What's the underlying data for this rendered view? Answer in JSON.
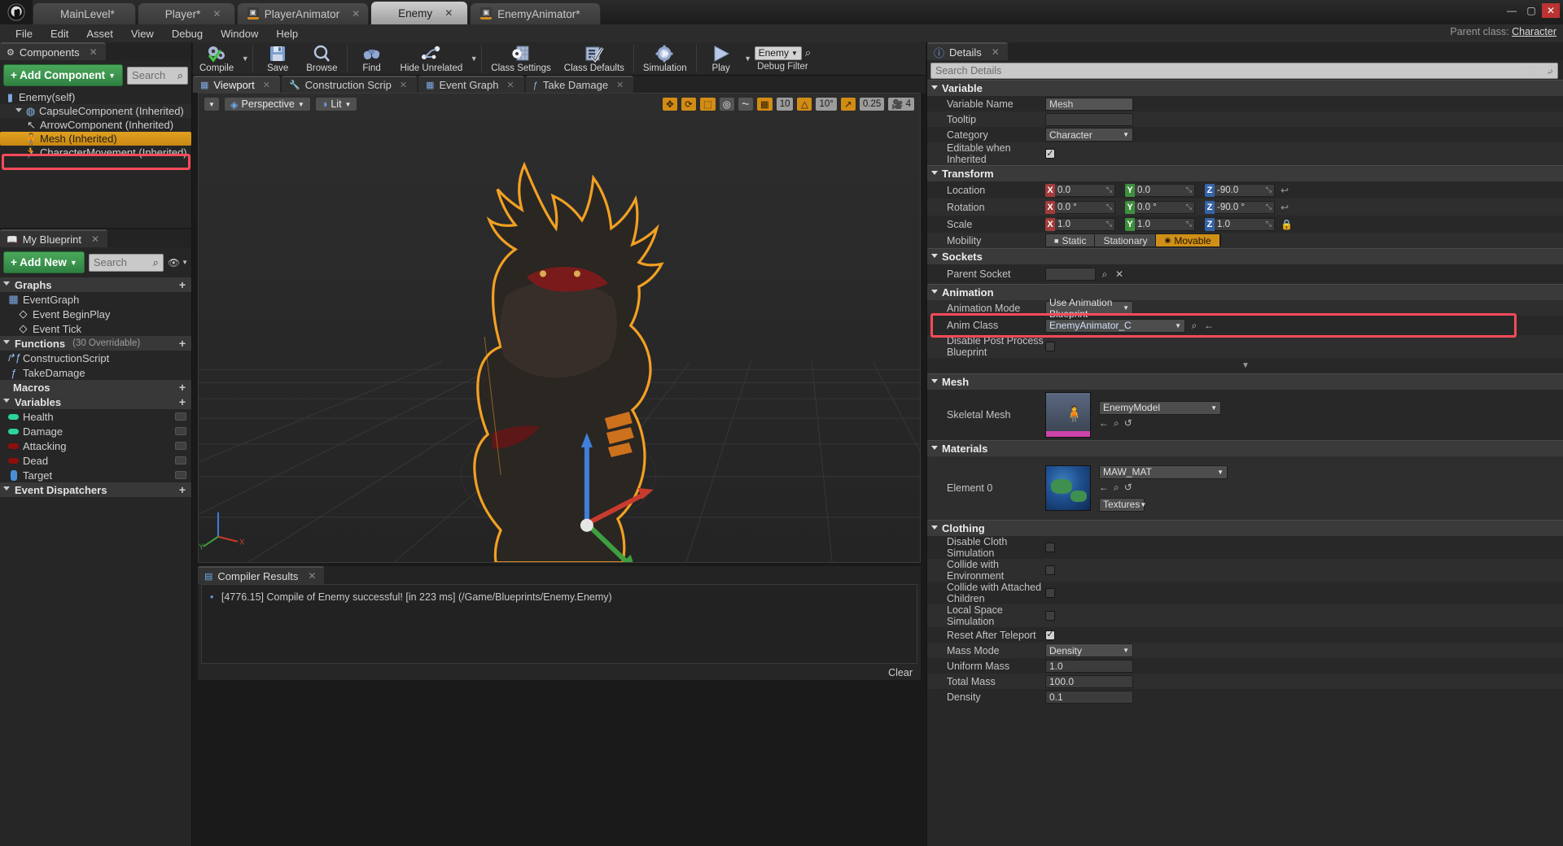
{
  "window": {
    "tabs": [
      {
        "label": "MainLevel*",
        "icon": "level-icon",
        "active": false,
        "closable": false
      },
      {
        "label": "Player*",
        "icon": "blueprint-icon",
        "active": false,
        "closable": true
      },
      {
        "label": "PlayerAnimator",
        "icon": "anim-blueprint-icon",
        "active": false,
        "closable": true
      },
      {
        "label": "Enemy",
        "icon": "blueprint-icon",
        "active": true,
        "closable": true
      },
      {
        "label": "EnemyAnimator*",
        "icon": "anim-blueprint-icon",
        "active": false,
        "closable": false
      }
    ],
    "controls": [
      "minimize",
      "maximize",
      "close"
    ]
  },
  "menu": {
    "items": [
      "File",
      "Edit",
      "Asset",
      "View",
      "Debug",
      "Window",
      "Help"
    ],
    "parent_class_label": "Parent class:",
    "parent_class_value": "Character"
  },
  "components": {
    "tab_label": "Components",
    "add_button": "+ Add Component",
    "search_placeholder": "Search",
    "tree": [
      {
        "label": "Enemy(self)",
        "icon": "blueprint-self-icon",
        "indent": 0,
        "selected": false
      },
      {
        "label": "CapsuleComponent (Inherited)",
        "icon": "capsule-icon",
        "indent": 1,
        "selected": false
      },
      {
        "label": "ArrowComponent (Inherited)",
        "icon": "arrow-icon",
        "indent": 2,
        "selected": false
      },
      {
        "label": "Mesh (Inherited)",
        "icon": "skeletal-mesh-icon",
        "indent": 2,
        "selected": true
      },
      {
        "label": "CharacterMovement (Inherited)",
        "icon": "movement-icon",
        "indent": 2,
        "selected": false
      }
    ]
  },
  "myblueprint": {
    "tab_label": "My Blueprint",
    "add_new_button": "+ Add New",
    "search_placeholder": "Search",
    "sections": [
      {
        "name": "Graphs",
        "sub": "",
        "items": [
          {
            "label": "EventGraph",
            "icon": "graph-icon",
            "indent": 1
          },
          {
            "label": "Event BeginPlay",
            "icon": "event-node-icon",
            "indent": 2
          },
          {
            "label": "Event Tick",
            "icon": "event-node-icon",
            "indent": 2
          }
        ]
      },
      {
        "name": "Functions",
        "sub": "(30 Overridable)",
        "items": [
          {
            "label": "ConstructionScript",
            "icon": "function-override-icon",
            "indent": 1
          },
          {
            "label": "TakeDamage",
            "icon": "function-icon",
            "indent": 1
          }
        ]
      },
      {
        "name": "Macros",
        "sub": "",
        "items": []
      },
      {
        "name": "Variables",
        "sub": "",
        "items": [
          {
            "label": "Health",
            "icon": "float-var-icon",
            "color": "#2bd49c",
            "indent": 1
          },
          {
            "label": "Damage",
            "icon": "float-var-icon",
            "color": "#2bd49c",
            "indent": 1
          },
          {
            "label": "Attacking",
            "icon": "bool-var-icon",
            "color": "#8f0d0d",
            "indent": 1
          },
          {
            "label": "Dead",
            "icon": "bool-var-icon",
            "color": "#8f0d0d",
            "indent": 1
          },
          {
            "label": "Target",
            "icon": "object-var-icon",
            "color": "#4a8fd8",
            "indent": 1
          }
        ]
      },
      {
        "name": "Event Dispatchers",
        "sub": "",
        "items": []
      }
    ]
  },
  "toolbar": {
    "buttons": [
      {
        "label": "Compile",
        "icon": "compile-icon",
        "caret": true
      },
      {
        "label": "Save",
        "icon": "save-icon",
        "caret": false
      },
      {
        "label": "Browse",
        "icon": "browse-icon",
        "caret": false
      },
      {
        "label": "Find",
        "icon": "find-icon",
        "caret": false
      },
      {
        "label": "Hide Unrelated",
        "icon": "hide-unrelated-icon",
        "caret": true
      },
      {
        "label": "Class Settings",
        "icon": "class-settings-icon",
        "caret": false
      },
      {
        "label": "Class Defaults",
        "icon": "class-defaults-icon",
        "caret": false
      },
      {
        "label": "Simulation",
        "icon": "simulation-icon",
        "caret": false
      },
      {
        "label": "Play",
        "icon": "play-icon",
        "caret": true
      }
    ],
    "debug_filter_label": "Debug Filter",
    "debug_filter_value": "Enemy"
  },
  "editor_tabs": [
    {
      "label": "Viewport",
      "icon": "viewport-icon",
      "active": true,
      "closable": true
    },
    {
      "label": "Construction Scrip",
      "icon": "construction-icon",
      "active": false,
      "closable": true
    },
    {
      "label": "Event Graph",
      "icon": "event-graph-icon",
      "active": false,
      "closable": true
    },
    {
      "label": "Take Damage",
      "icon": "function-graph-icon",
      "active": false,
      "closable": true
    }
  ],
  "viewport": {
    "view_mode": "Perspective",
    "lit_mode": "Lit",
    "snap_values": {
      "grid_snap": "10",
      "rotation_snap": "10°",
      "scale_snap": "0.25",
      "camera_speed": "4"
    }
  },
  "compiler_results": {
    "tab_label": "Compiler Results",
    "messages": [
      "[4776.15] Compile of Enemy successful! [in 223 ms] (/Game/Blueprints/Enemy.Enemy)"
    ],
    "clear_label": "Clear"
  },
  "details": {
    "tab_label": "Details",
    "search_placeholder": "Search Details",
    "sections": [
      {
        "name": "Variable",
        "rows": [
          {
            "label": "Variable Name",
            "type": "text",
            "value": "Mesh",
            "readonly": true
          },
          {
            "label": "Tooltip",
            "type": "text",
            "value": "",
            "readonly": false
          },
          {
            "label": "Category",
            "type": "combo",
            "value": "Character"
          },
          {
            "label": "Editable when Inherited",
            "type": "check",
            "value": true
          }
        ]
      },
      {
        "name": "Transform",
        "rows": [
          {
            "label": "Location",
            "type": "vector",
            "value": [
              "0.0",
              "0.0",
              "-90.0"
            ],
            "revert": true
          },
          {
            "label": "Rotation",
            "type": "vector",
            "value": [
              "0.0 °",
              "0.0 °",
              "-90.0 °"
            ],
            "revert": true
          },
          {
            "label": "Scale",
            "type": "vector",
            "value": [
              "1.0",
              "1.0",
              "1.0"
            ],
            "lock": true
          },
          {
            "label": "Mobility",
            "type": "mobility",
            "value": "Movable",
            "options": [
              "Static",
              "Stationary",
              "Movable"
            ]
          }
        ]
      },
      {
        "name": "Sockets",
        "rows": [
          {
            "label": "Parent Socket",
            "type": "socket",
            "value": ""
          }
        ]
      },
      {
        "name": "Animation",
        "rows": [
          {
            "label": "Animation Mode",
            "type": "combo",
            "value": "Use Animation Blueprint"
          },
          {
            "label": "Anim Class",
            "type": "asset-combo",
            "value": "EnemyAnimator_C",
            "highlighted": true
          },
          {
            "label": "Disable Post Process Blueprint",
            "type": "check",
            "value": false
          }
        ]
      },
      {
        "name": "Mesh",
        "rows": [
          {
            "label": "Skeletal Mesh",
            "type": "asset-thumb",
            "value": "EnemyModel"
          }
        ]
      },
      {
        "name": "Materials",
        "rows": [
          {
            "label": "Element 0",
            "type": "asset-thumb-mat",
            "value": "MAW_MAT",
            "extra_button": "Textures"
          }
        ]
      },
      {
        "name": "Clothing",
        "rows": [
          {
            "label": "Disable Cloth Simulation",
            "type": "check",
            "value": false
          },
          {
            "label": "Collide with Environment",
            "type": "check",
            "value": false
          },
          {
            "label": "Collide with Attached Children",
            "type": "check",
            "value": false
          },
          {
            "label": "Local Space Simulation",
            "type": "check",
            "value": false
          },
          {
            "label": "Reset After Teleport",
            "type": "check",
            "value": true
          },
          {
            "label": "Mass Mode",
            "type": "combo",
            "value": "Density"
          },
          {
            "label": "Uniform Mass",
            "type": "text",
            "value": "1.0"
          },
          {
            "label": "Total Mass",
            "type": "text",
            "value": "100.0"
          },
          {
            "label": "Density",
            "type": "text",
            "value": "0.1"
          }
        ]
      }
    ]
  },
  "colors": {
    "accent_orange": "#d09017",
    "highlight_red": "#fb4a5a",
    "green_button": "#3d9950",
    "panel_bg": "#282828"
  }
}
